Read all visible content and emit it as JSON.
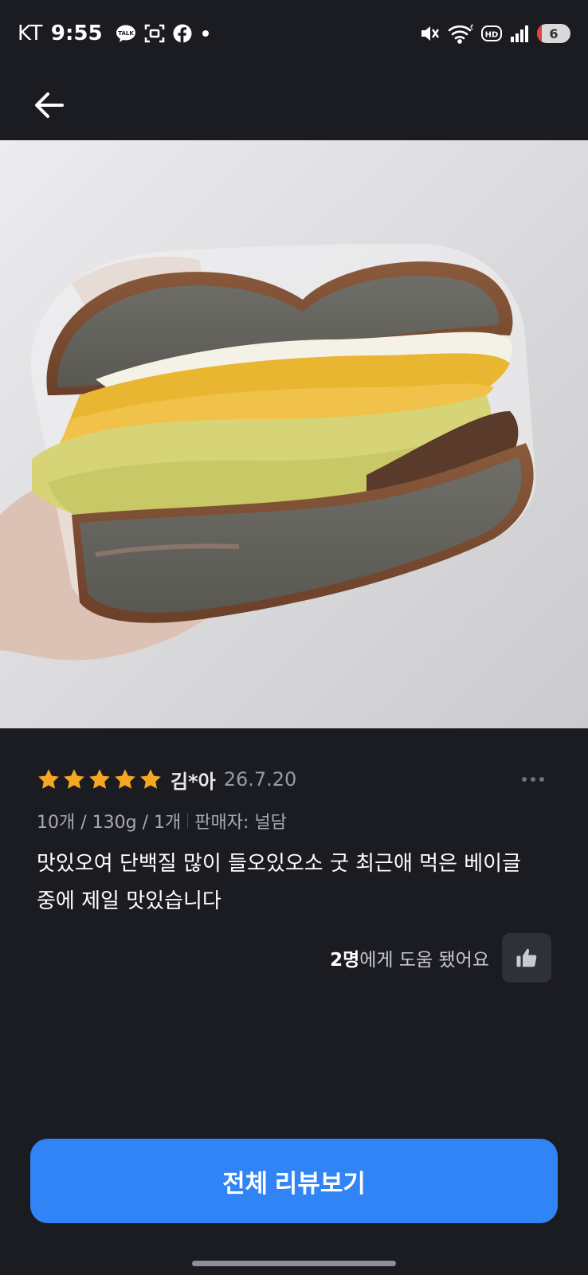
{
  "status_bar": {
    "carrier": "KT",
    "time": "9:55",
    "battery_level": "6",
    "notification_icons": [
      "kakaotalk-icon",
      "screenshot-icon",
      "facebook-icon",
      "dot-icon"
    ],
    "system_icons": [
      "mute-icon",
      "wifi-icon",
      "hd-icon",
      "signal-icon",
      "battery-icon"
    ]
  },
  "nav": {
    "back_icon": "arrow-left-icon"
  },
  "photo": {
    "subject": "sandwich-photo"
  },
  "review": {
    "rating": 5,
    "rating_max": 5,
    "star_color": "#f5a623",
    "reviewer": "김*아",
    "date": "26.7.20",
    "option_text": "10개 / 130g / 1개",
    "seller_text": "판매자: 널담",
    "body": "맛있오여 단백질 많이 들오있오소 굿 최근애 먹은 베이글\n중에 제일 맛있습니다",
    "helpful_count": "2명",
    "helpful_suffix": "에게 도움 됐어요"
  },
  "footer": {
    "all_reviews_label": "전체 리뷰보기",
    "button_color": "#3184f5"
  }
}
